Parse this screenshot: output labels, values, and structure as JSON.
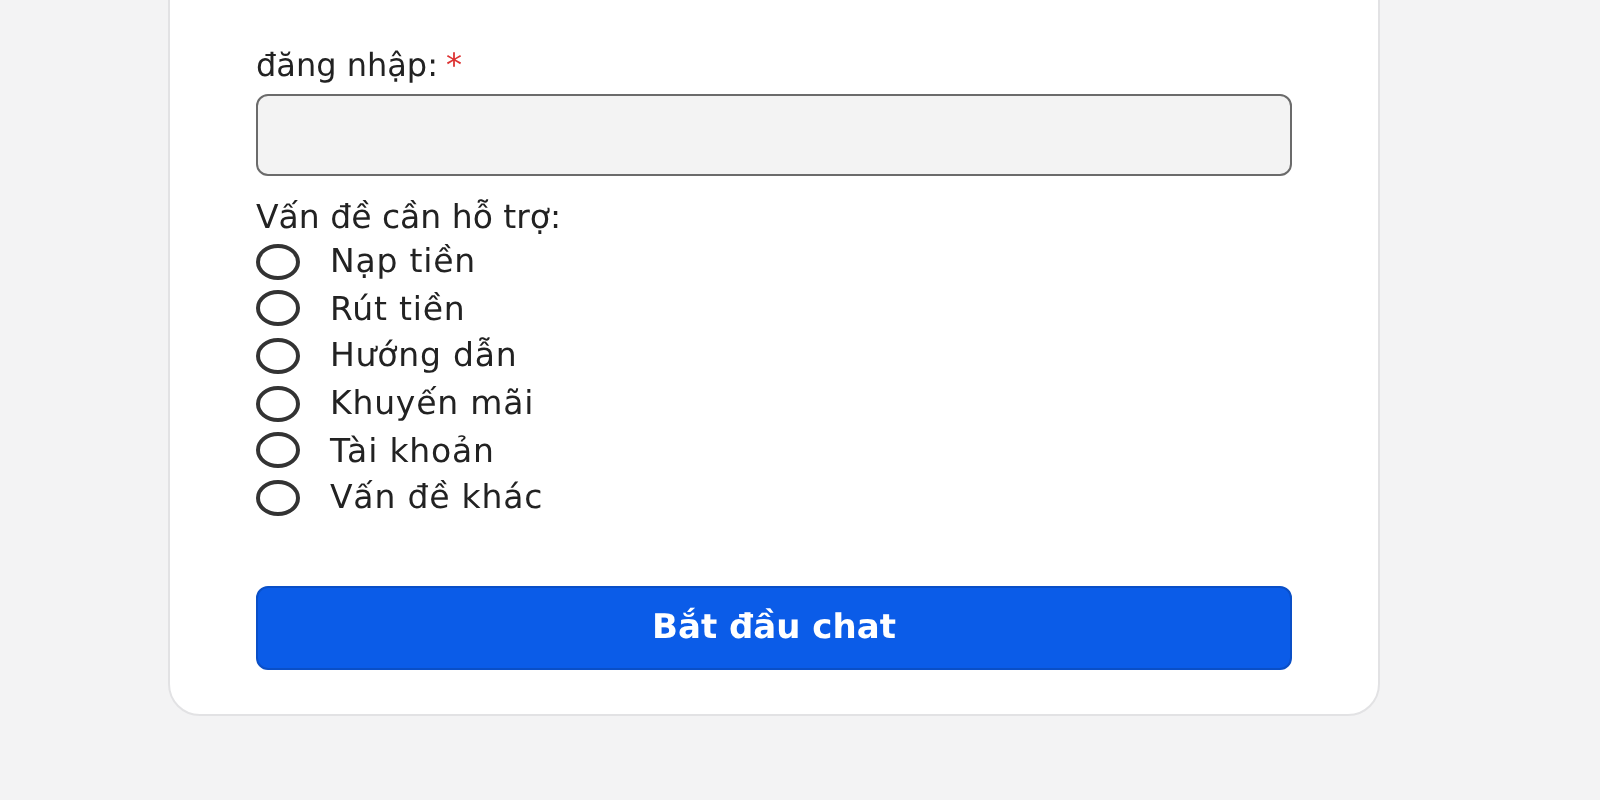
{
  "form": {
    "username": {
      "label": "đăng nhập:",
      "required_mark": "*"
    },
    "topic": {
      "label": "Vấn đề cần hỗ trợ:",
      "options": [
        {
          "label": "Nạp tiền",
          "selected": false
        },
        {
          "label": "Rút tiền",
          "selected": false
        },
        {
          "label": "Hướng dẫn",
          "selected": false
        },
        {
          "label": "Khuyến mãi",
          "selected": false
        },
        {
          "label": "Tài khoản",
          "selected": false
        },
        {
          "label": "Vấn đề khác",
          "selected": false
        }
      ]
    },
    "submit": "Bắt đầu chat"
  }
}
